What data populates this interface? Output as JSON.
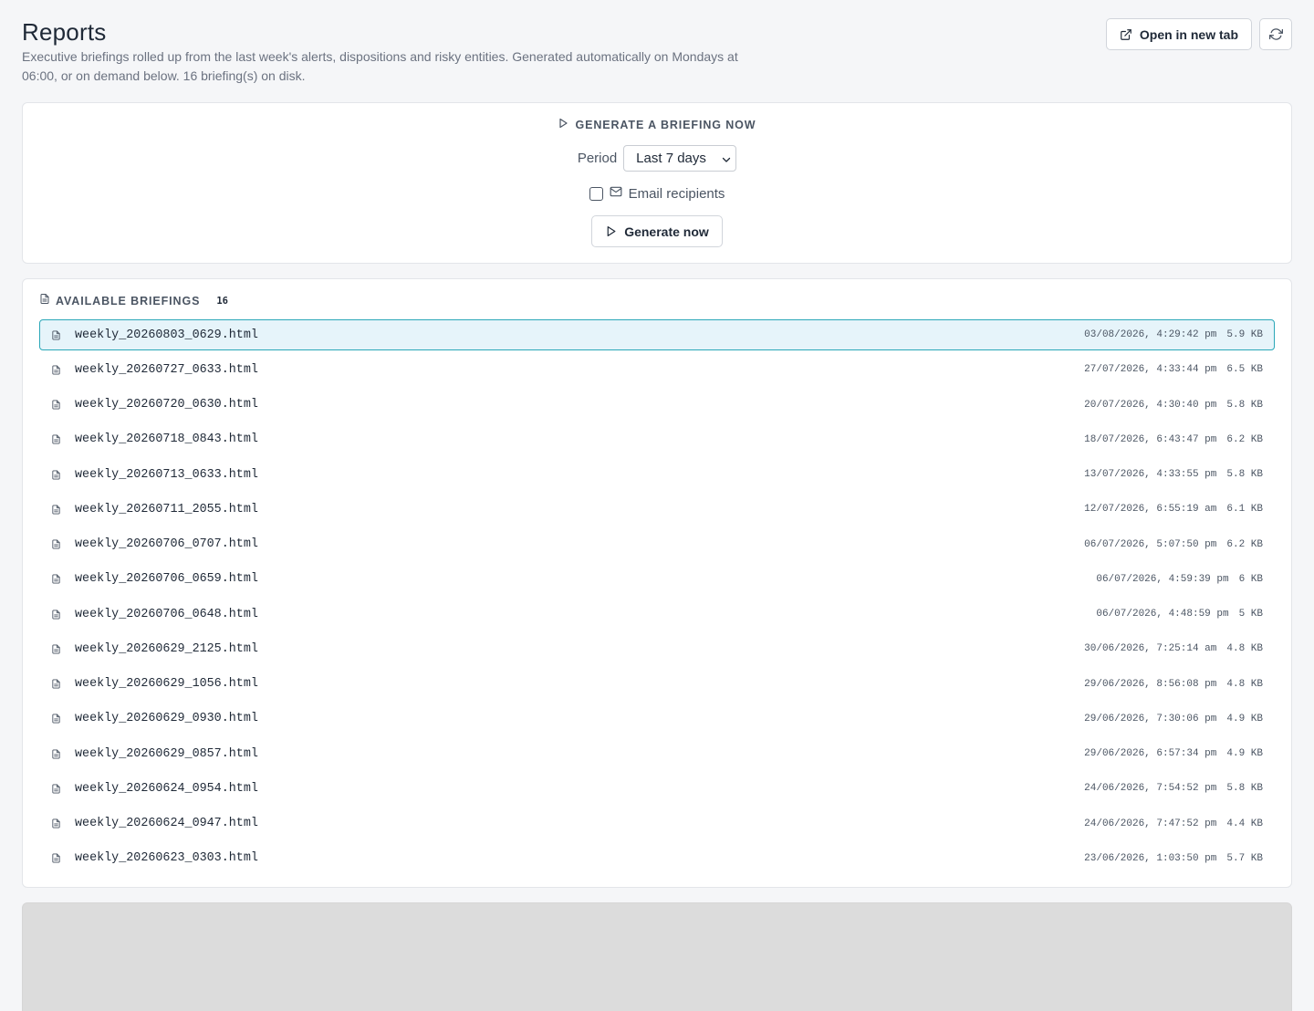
{
  "header": {
    "title": "Reports",
    "subtitle": "Executive briefings rolled up from the last week's alerts, dispositions and risky entities. Generated automatically on Mondays at 06:00, or on demand below. 16 briefing(s) on disk.",
    "open_new_tab_label": "Open in new tab",
    "open_new_tab_icon": "external-link-icon",
    "refresh_icon": "refresh-icon"
  },
  "generate": {
    "section_title": "GENERATE A BRIEFING NOW",
    "section_icon": "play-icon",
    "period_label": "Period",
    "period_value": "Last 7 days",
    "email_checked": false,
    "email_icon": "mail-icon",
    "email_label": "Email recipients",
    "button_label": "Generate now",
    "button_icon": "play-icon"
  },
  "briefings": {
    "section_title": "AVAILABLE BRIEFINGS",
    "section_icon": "file-icon",
    "count": "16",
    "accent_color": "#2aa7b8",
    "selected_bg": "#e6f4fa",
    "items": [
      {
        "name": "weekly_20260803_0629.html",
        "date": "03/08/2026, 4:29:42 pm",
        "size": "5.9 KB",
        "selected": true
      },
      {
        "name": "weekly_20260727_0633.html",
        "date": "27/07/2026, 4:33:44 pm",
        "size": "6.5 KB"
      },
      {
        "name": "weekly_20260720_0630.html",
        "date": "20/07/2026, 4:30:40 pm",
        "size": "5.8 KB"
      },
      {
        "name": "weekly_20260718_0843.html",
        "date": "18/07/2026, 6:43:47 pm",
        "size": "6.2 KB"
      },
      {
        "name": "weekly_20260713_0633.html",
        "date": "13/07/2026, 4:33:55 pm",
        "size": "5.8 KB"
      },
      {
        "name": "weekly_20260711_2055.html",
        "date": "12/07/2026, 6:55:19 am",
        "size": "6.1 KB"
      },
      {
        "name": "weekly_20260706_0707.html",
        "date": "06/07/2026, 5:07:50 pm",
        "size": "6.2 KB"
      },
      {
        "name": "weekly_20260706_0659.html",
        "date": "06/07/2026, 4:59:39 pm",
        "size": "6 KB"
      },
      {
        "name": "weekly_20260706_0648.html",
        "date": "06/07/2026, 4:48:59 pm",
        "size": "5 KB"
      },
      {
        "name": "weekly_20260629_2125.html",
        "date": "30/06/2026, 7:25:14 am",
        "size": "4.8 KB"
      },
      {
        "name": "weekly_20260629_1056.html",
        "date": "29/06/2026, 8:56:08 pm",
        "size": "4.8 KB"
      },
      {
        "name": "weekly_20260629_0930.html",
        "date": "29/06/2026, 7:30:06 pm",
        "size": "4.9 KB"
      },
      {
        "name": "weekly_20260629_0857.html",
        "date": "29/06/2026, 6:57:34 pm",
        "size": "4.9 KB"
      },
      {
        "name": "weekly_20260624_0954.html",
        "date": "24/06/2026, 7:54:52 pm",
        "size": "5.8 KB"
      },
      {
        "name": "weekly_20260624_0947.html",
        "date": "24/06/2026, 7:47:52 pm",
        "size": "4.4 KB"
      },
      {
        "name": "weekly_20260623_0303.html",
        "date": "23/06/2026, 1:03:50 pm",
        "size": "5.7 KB"
      }
    ]
  }
}
